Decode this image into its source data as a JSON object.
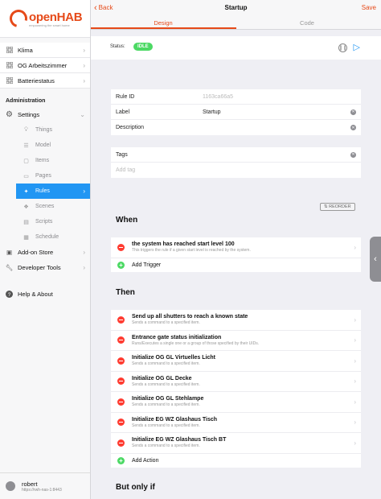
{
  "brand": {
    "name": "openHAB",
    "tagline": "empowering the smart home"
  },
  "sidebar": {
    "groups": [
      {
        "label": "Klima",
        "icon": "grid-icon"
      },
      {
        "label": "OG Arbeitszimmer",
        "icon": "grid-icon"
      },
      {
        "label": "Batteriestatus",
        "icon": "grid-icon"
      }
    ],
    "admin_title": "Administration",
    "settings": "Settings",
    "sub": {
      "things": "Things",
      "model": "Model",
      "items": "Items",
      "pages": "Pages",
      "rules": "Rules",
      "scenes": "Scenes",
      "scripts": "Scripts",
      "schedule": "Schedule"
    },
    "addon_store": "Add-on Store",
    "developer_tools": "Developer Tools",
    "help": "Help & About",
    "user": {
      "name": "robert",
      "host": "https://rwh-nas-1:8443"
    }
  },
  "topbar": {
    "back": "Back",
    "title": "Startup",
    "save": "Save",
    "tabs": {
      "design": "Design",
      "code": "Code"
    }
  },
  "status": {
    "label": "Status:",
    "value": "IDLE"
  },
  "form": {
    "rule_id_label": "Rule ID",
    "rule_id_value": "1163ca66a5",
    "label_label": "Label",
    "label_value": "Startup",
    "description_label": "Description",
    "tags_label": "Tags",
    "add_tag_placeholder": "Add tag"
  },
  "reorder": "REORDER",
  "when": {
    "title": "When",
    "items": [
      {
        "title": "the system has reached start level 100",
        "desc": "This triggers the rule if a given start level is reached by the system."
      }
    ],
    "add": "Add Trigger"
  },
  "then": {
    "title": "Then",
    "items": [
      {
        "title": "Send up all shutters to reach a known state",
        "desc": "Sends a command to a specified item."
      },
      {
        "title": "Entrance gate status initialization",
        "desc": "Runs/Executes a single one or a group of those specified by their UIDs."
      },
      {
        "title": "Initialize OG GL Virtuelles Licht",
        "desc": "Sends a command to a specified item."
      },
      {
        "title": "Initialize OG GL Decke",
        "desc": "Sends a command to a specified item."
      },
      {
        "title": "Initialize OG GL Stehlampe",
        "desc": "Sends a command to a specified item."
      },
      {
        "title": "Initialize EG WZ Glashaus Tisch",
        "desc": "Sends a command to a specified item."
      },
      {
        "title": "Initialize EG WZ Glashaus Tisch BT",
        "desc": "Sends a command to a specified item."
      }
    ],
    "add": "Add Action"
  },
  "but_only_if": {
    "title": "But only if"
  },
  "colors": {
    "accent": "#e64a19",
    "active": "#2196f3",
    "idle": "#4cd964",
    "remove": "#ff3b30"
  }
}
